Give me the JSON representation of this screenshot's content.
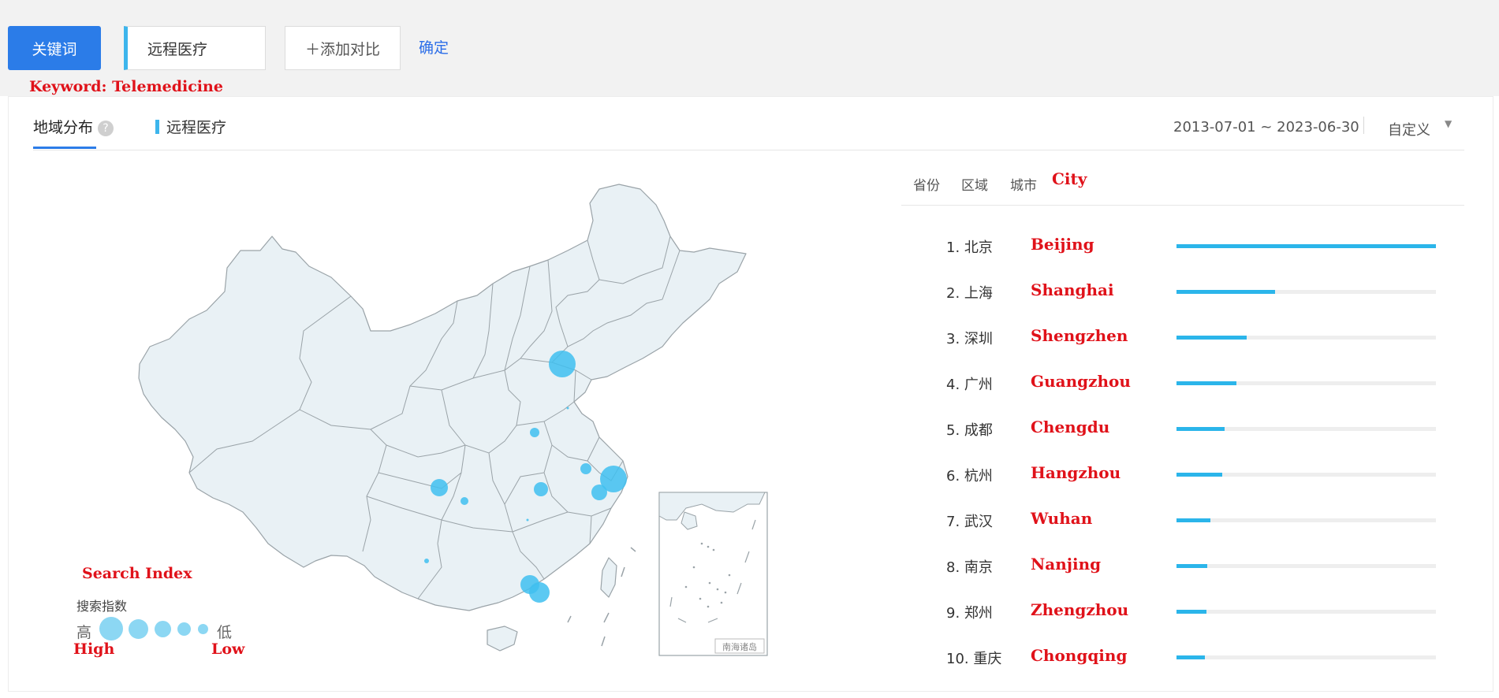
{
  "search": {
    "keyword_button": "关键词",
    "keyword_value": "远程医疗",
    "add_compare": "＋添加对比",
    "confirm": "确定"
  },
  "annotations": {
    "keyword_label": "Keyword:  Telemedicine",
    "city_label": "City",
    "search_index_label": "Search Index",
    "high_label": "High",
    "low_label": "Low"
  },
  "panel": {
    "tab_region": "地域分布",
    "help_icon": "?",
    "series_keyword": "远程医疗",
    "date_range": "2013-07-01 ~ 2023-06-30",
    "custom": "自定义",
    "dropdown_caret": "▼",
    "subtabs": [
      "省份",
      "区域",
      "城市"
    ]
  },
  "ranking": [
    {
      "label": "1.  北京",
      "en": "Beijing",
      "value": 1.0
    },
    {
      "label": "2.  上海",
      "en": "Shanghai",
      "value": 0.38
    },
    {
      "label": "3.  深圳",
      "en": "Shengzhen",
      "value": 0.27
    },
    {
      "label": "4.  广州",
      "en": "Guangzhou",
      "value": 0.23
    },
    {
      "label": "5.  成都",
      "en": "Chengdu",
      "value": 0.185
    },
    {
      "label": "6.  杭州",
      "en": "Hangzhou",
      "value": 0.175
    },
    {
      "label": "7.  武汉",
      "en": "Wuhan",
      "value": 0.13
    },
    {
      "label": "8.  南京",
      "en": "Nanjing",
      "value": 0.12
    },
    {
      "label": "9.  郑州",
      "en": "Zhengzhou",
      "value": 0.115
    },
    {
      "label": "10. 重庆",
      "en": "Chongqing",
      "value": 0.11
    }
  ],
  "map": {
    "inset_label": "南海诸岛"
  },
  "legend": {
    "title": "搜索指数",
    "high": "高",
    "low": "低"
  },
  "colors": {
    "accent_blue": "#2b7ce8",
    "bar_cyan": "#2bb5ea",
    "bubble": "#3fc0f0",
    "annotation_red": "#e0121a"
  }
}
